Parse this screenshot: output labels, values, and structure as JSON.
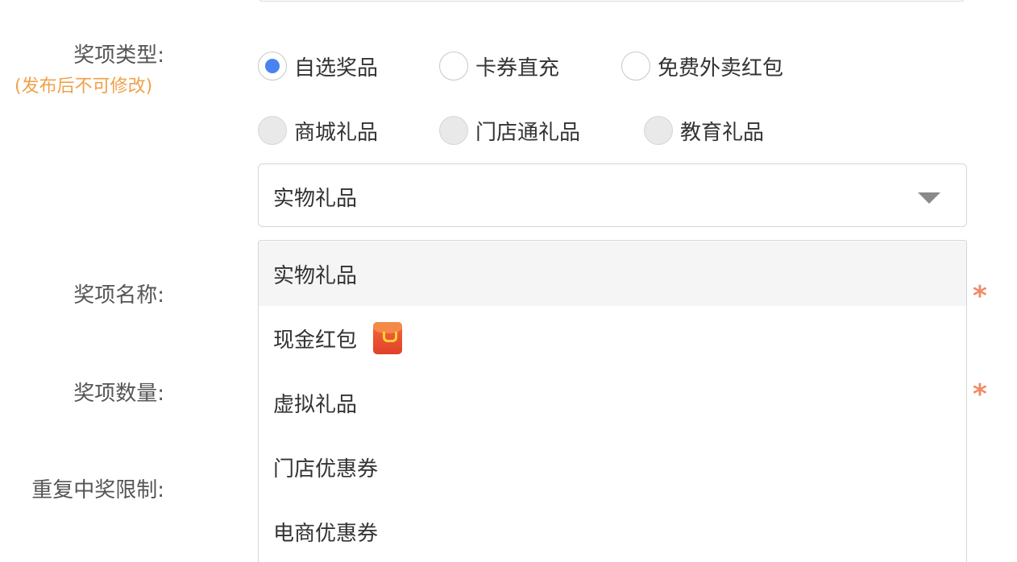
{
  "form": {
    "prize_type_label": "奖项类型:",
    "prize_type_note": "(发布后不可修改)",
    "prize_name_label": "奖项名称:",
    "prize_quantity_label": "奖项数量:",
    "repeat_limit_label": "重复中奖限制:",
    "required_mark": "*"
  },
  "prize_types": [
    {
      "label": "自选奖品",
      "checked": true,
      "disabled": false
    },
    {
      "label": "卡券直充",
      "checked": false,
      "disabled": false
    },
    {
      "label": "免费外卖红包",
      "checked": false,
      "disabled": false
    },
    {
      "label": "商城礼品",
      "checked": false,
      "disabled": true
    },
    {
      "label": "门店通礼品",
      "checked": false,
      "disabled": true
    },
    {
      "label": "教育礼品",
      "checked": false,
      "disabled": true
    }
  ],
  "select": {
    "value": "实物礼品",
    "icon": "chevron-down-icon",
    "options": [
      {
        "label": "实物礼品",
        "active": true
      },
      {
        "label": "现金红包",
        "icon": "red-packet-icon"
      },
      {
        "label": "虚拟礼品"
      },
      {
        "label": "门店优惠券"
      },
      {
        "label": "电商优惠券"
      }
    ]
  },
  "colors": {
    "accent": "#4a83f0",
    "note": "#f0a14a",
    "required": "#f08a66",
    "active_option_bg": "#f5f5f5"
  }
}
